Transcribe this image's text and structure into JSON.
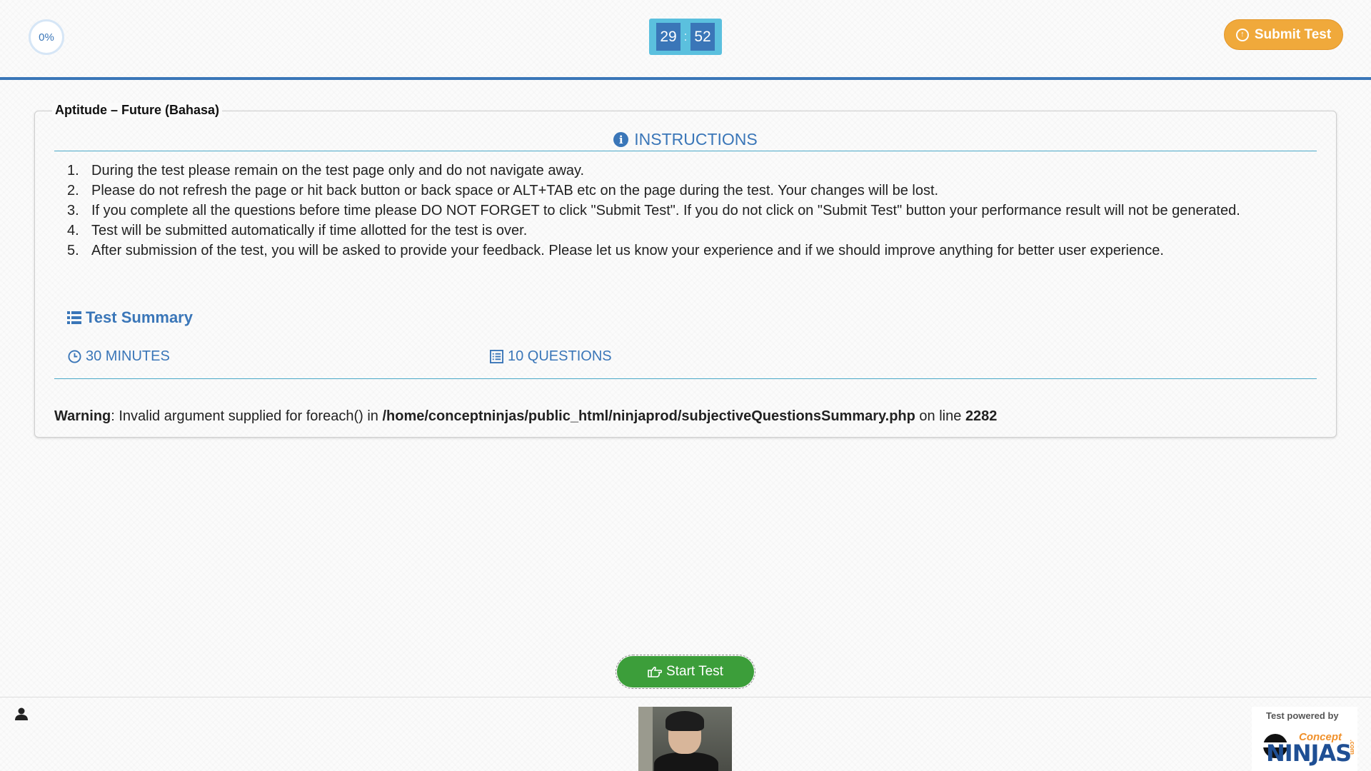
{
  "header": {
    "progress": "0%",
    "progress_value": 0,
    "timer": {
      "minutes": "29",
      "separator": ":",
      "seconds": "52"
    },
    "submit_label": "Submit Test"
  },
  "test": {
    "title": "Aptitude – Future (Bahasa)",
    "instructions_heading": "INSTRUCTIONS",
    "instructions": [
      {
        "num": "1.",
        "text": "During the test please remain on the test page only and do not navigate away."
      },
      {
        "num": "2.",
        "text": "Please do not refresh the page or hit back button or back space or ALT+TAB etc on the page during the test. Your changes will be lost."
      },
      {
        "num": "3.",
        "text": "If you complete all the questions before time please DO NOT FORGET to click \"Submit Test\". If you do not click on \"Submit Test\" button your performance result will not be generated."
      },
      {
        "num": "4.",
        "text": "Test will be submitted automatically if time allotted for the test is over."
      },
      {
        "num": "5.",
        "text": "After submission of the test, you will be asked to provide your feedback. Please let us know your experience and if we should improve anything for better user experience."
      }
    ],
    "summary_heading": "Test Summary",
    "duration": "30 MINUTES",
    "questions": "10 QUESTIONS"
  },
  "warning": {
    "label": "Warning",
    "message": ": Invalid argument supplied for foreach() in ",
    "path": "/home/conceptninjas/public_html/ninjaprod/subjectiveQuestionsSummary.php",
    "line_text": " on line ",
    "line": "2282"
  },
  "start_label": "Start Test",
  "footer": {
    "powered_by": "Test powered by",
    "brand_top": "Concept",
    "brand_main": "NINJAS",
    "brand_suffix": ".com"
  },
  "colors": {
    "accent": "#3a76b8",
    "submit": "#f0a93b",
    "start": "#3c9e3a",
    "timer_bg": "#5bc0de"
  },
  "icons": {
    "submit": "arrow-up-circle-icon",
    "instructions": "info-icon",
    "summary": "list-icon",
    "duration": "clock-icon",
    "questions": "list-alt-icon",
    "start": "hand-pointer-icon",
    "user": "user-icon"
  }
}
